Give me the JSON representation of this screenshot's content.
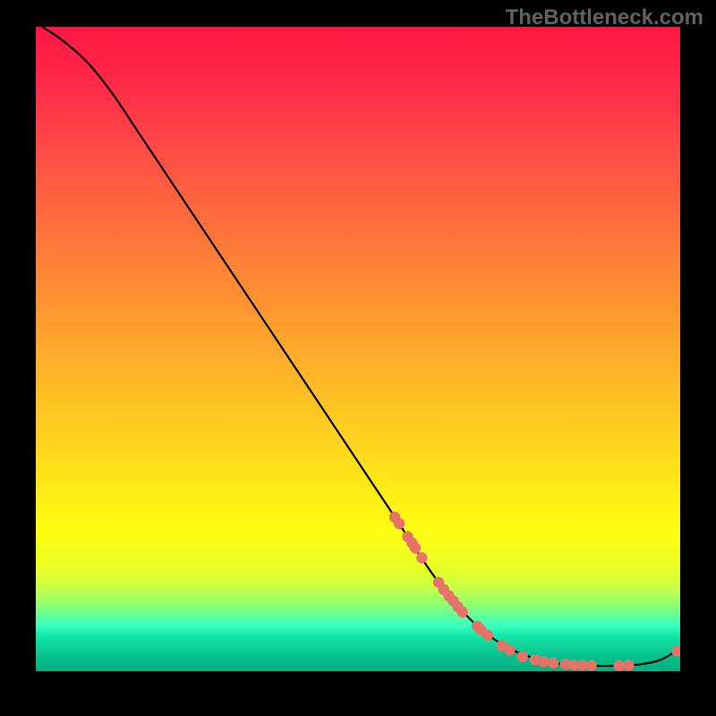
{
  "watermark": "TheBottleneck.com",
  "chart_data": {
    "type": "line",
    "title": "",
    "xlabel": "",
    "ylabel": "",
    "xlim": [
      0,
      100
    ],
    "ylim": [
      0,
      100
    ],
    "curve_points": [
      {
        "x": 1,
        "y": 100
      },
      {
        "x": 4,
        "y": 98
      },
      {
        "x": 8,
        "y": 94.5
      },
      {
        "x": 12,
        "y": 89.5
      },
      {
        "x": 16,
        "y": 83.5
      },
      {
        "x": 25,
        "y": 70
      },
      {
        "x": 35,
        "y": 55
      },
      {
        "x": 45,
        "y": 40
      },
      {
        "x": 55,
        "y": 25
      },
      {
        "x": 62,
        "y": 14.5
      },
      {
        "x": 68,
        "y": 7.5
      },
      {
        "x": 74,
        "y": 3.3
      },
      {
        "x": 80,
        "y": 1.4
      },
      {
        "x": 85,
        "y": 0.9
      },
      {
        "x": 90,
        "y": 0.85
      },
      {
        "x": 94,
        "y": 1.1
      },
      {
        "x": 97,
        "y": 1.8
      },
      {
        "x": 99.5,
        "y": 3.2
      }
    ],
    "marker_points": [
      {
        "x": 55.7,
        "y": 23.9
      },
      {
        "x": 56.4,
        "y": 22.9
      },
      {
        "x": 57.7,
        "y": 20.9
      },
      {
        "x": 58.4,
        "y": 19.9
      },
      {
        "x": 58.9,
        "y": 19.1
      },
      {
        "x": 59.9,
        "y": 17.6
      },
      {
        "x": 62.5,
        "y": 13.8
      },
      {
        "x": 63.3,
        "y": 12.7
      },
      {
        "x": 64.1,
        "y": 11.7
      },
      {
        "x": 64.8,
        "y": 10.9
      },
      {
        "x": 65.5,
        "y": 10.0
      },
      {
        "x": 66.2,
        "y": 9.2
      },
      {
        "x": 68.5,
        "y": 7.0
      },
      {
        "x": 69.0,
        "y": 6.5
      },
      {
        "x": 70.1,
        "y": 5.6
      },
      {
        "x": 72.3,
        "y": 4.0
      },
      {
        "x": 73.5,
        "y": 3.3
      },
      {
        "x": 75.5,
        "y": 2.3
      },
      {
        "x": 77.5,
        "y": 1.8
      },
      {
        "x": 78.8,
        "y": 1.5
      },
      {
        "x": 80.3,
        "y": 1.3
      },
      {
        "x": 82.2,
        "y": 1.1
      },
      {
        "x": 83.5,
        "y": 1.0
      },
      {
        "x": 84.8,
        "y": 0.95
      },
      {
        "x": 86.2,
        "y": 0.9
      },
      {
        "x": 90.5,
        "y": 0.88
      },
      {
        "x": 92.0,
        "y": 0.93
      },
      {
        "x": 99.5,
        "y": 3.2
      }
    ],
    "marker_color": "#e57368",
    "curve_stroke": "#000000"
  }
}
